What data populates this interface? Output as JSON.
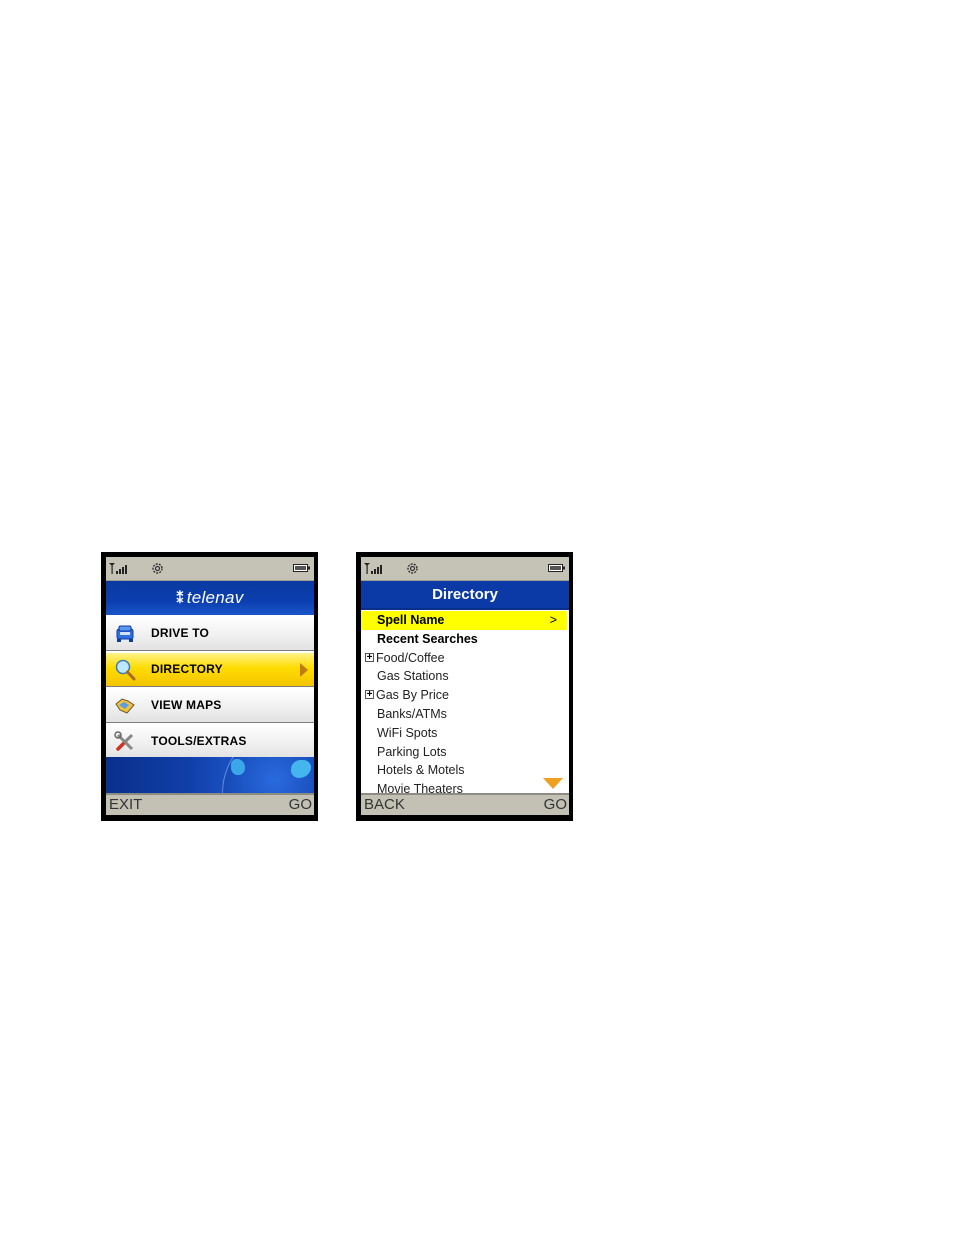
{
  "left_phone": {
    "status": {
      "signal_icon": "signal-bars-icon",
      "settings_icon": "gear-icon",
      "battery_icon": "battery-icon"
    },
    "header": {
      "logo_mark": "⁑",
      "logo_text": "telenav"
    },
    "menu": [
      {
        "label": "DRIVE TO",
        "icon": "car-icon",
        "selected": false
      },
      {
        "label": "DIRECTORY",
        "icon": "magnifier-icon",
        "selected": true
      },
      {
        "label": "VIEW MAPS",
        "icon": "map-icon",
        "selected": false
      },
      {
        "label": "TOOLS/EXTRAS",
        "icon": "tools-icon",
        "selected": false
      }
    ],
    "softkeys": {
      "left": "EXIT",
      "right": "GO"
    }
  },
  "right_phone": {
    "status": {
      "signal_icon": "signal-bars-icon",
      "settings_icon": "gear-icon",
      "battery_icon": "battery-icon"
    },
    "header": {
      "title": "Directory"
    },
    "list": [
      {
        "label": "Spell Name",
        "bold": true,
        "highlight": true,
        "chevron": ">"
      },
      {
        "label": "Recent Searches",
        "bold": true
      },
      {
        "label": "Food/Coffee",
        "expander": "+"
      },
      {
        "label": "Gas Stations"
      },
      {
        "label": "Gas By Price",
        "expander": "+"
      },
      {
        "label": "Banks/ATMs"
      },
      {
        "label": "WiFi Spots"
      },
      {
        "label": "Parking Lots"
      },
      {
        "label": "Hotels & Motels"
      },
      {
        "label": "Movie Theaters"
      }
    ],
    "softkeys": {
      "left": "BACK",
      "right": "GO"
    }
  }
}
